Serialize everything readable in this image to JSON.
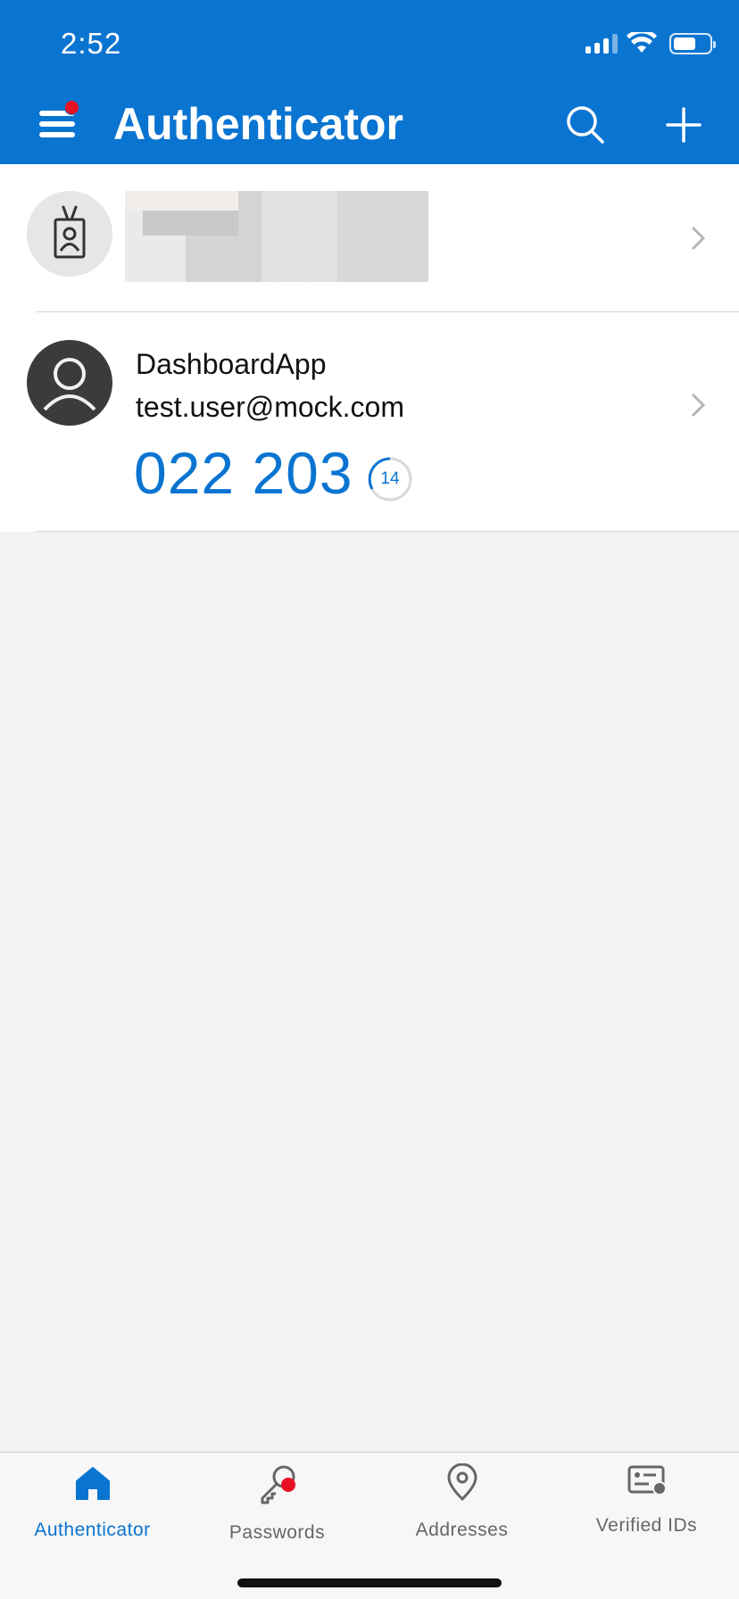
{
  "status_bar": {
    "time": "2:52"
  },
  "header": {
    "title": "Authenticator",
    "menu_icon": "hamburger-menu-icon",
    "search_icon": "search-icon",
    "add_icon": "plus-icon",
    "accent_color": "#0a74d1",
    "notification_color": "#e81123"
  },
  "accounts": [
    {
      "icon": "id-badge-icon",
      "name": "",
      "email": "",
      "redacted": true
    },
    {
      "icon": "person-icon",
      "name": "DashboardApp",
      "email": "test.user@mock.com",
      "code": "022 203",
      "seconds_left": "14"
    }
  ],
  "tabs": [
    {
      "label": "Authenticator",
      "icon": "home-icon",
      "active": true
    },
    {
      "label": "Passwords",
      "icon": "key-icon",
      "active": false
    },
    {
      "label": "Addresses",
      "icon": "location-pin-icon",
      "active": false
    },
    {
      "label": "Verified IDs",
      "icon": "verified-id-card-icon",
      "active": false
    }
  ]
}
